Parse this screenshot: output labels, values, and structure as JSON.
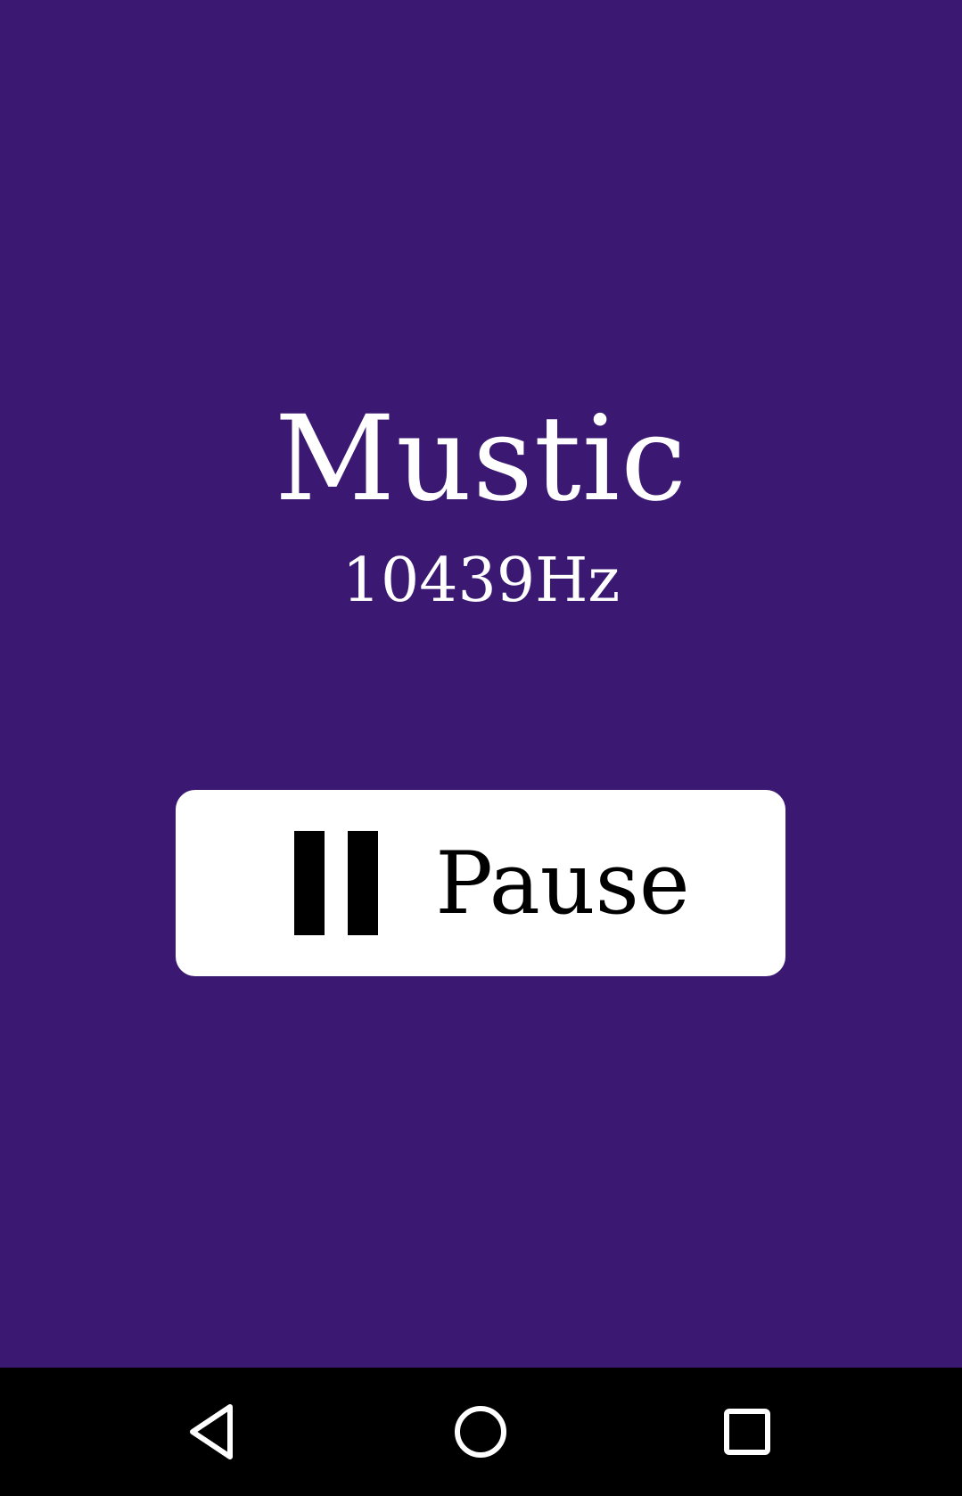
{
  "app": {
    "title": "Mustic",
    "frequency": "10439Hz",
    "background_color": "#3b1872"
  },
  "controls": {
    "pause_label": "Pause",
    "pause_icon": "pause-icon"
  },
  "navigation": {
    "back_icon": "back-triangle-icon",
    "home_icon": "home-circle-icon",
    "recents_icon": "recents-square-icon"
  }
}
